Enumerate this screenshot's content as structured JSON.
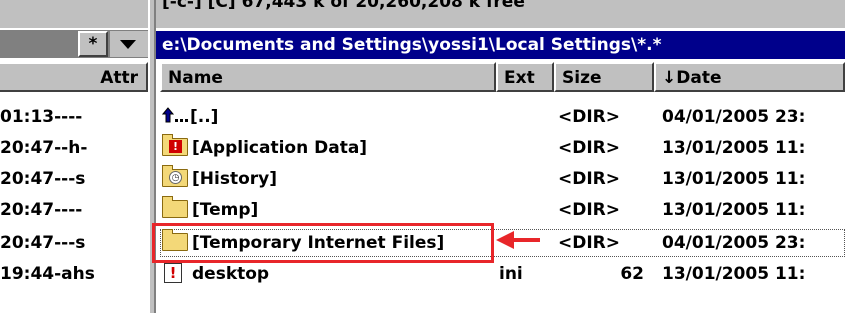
{
  "toolbar_top": {
    "text": "[-c-] [C] 67,443 k of 20,260,208 k free"
  },
  "left_pane": {
    "filter_label": "*",
    "attr_header": "Attr",
    "rows": [
      {
        "attr": "01:13----"
      },
      {
        "attr": "20:47--h-"
      },
      {
        "attr": "20:47---s"
      },
      {
        "attr": "20:47----"
      },
      {
        "attr": "20:47---s"
      },
      {
        "attr": "19:44-ahs"
      }
    ]
  },
  "path_bar": {
    "path": "e:\\Documents and Settings\\yossi1\\Local Settings\\*.*"
  },
  "columns": {
    "name": "Name",
    "ext": "Ext",
    "size": "Size",
    "date": "↓Date"
  },
  "files": [
    {
      "icon": "up-arrow-icon",
      "name": "[..]",
      "ext": "",
      "size": "<DIR>",
      "date": "04/01/2005 23:"
    },
    {
      "icon": "folder-warning-icon",
      "name": "[Application Data]",
      "ext": "",
      "size": "<DIR>",
      "date": "13/01/2005 11:"
    },
    {
      "icon": "folder-history-icon",
      "name": "[History]",
      "ext": "",
      "size": "<DIR>",
      "date": "13/01/2005 11:"
    },
    {
      "icon": "folder-icon",
      "name": "[Temp]",
      "ext": "",
      "size": "<DIR>",
      "date": "13/01/2005 11:"
    },
    {
      "icon": "folder-icon",
      "name": "[Temporary Internet Files]",
      "ext": "",
      "size": "<DIR>",
      "date": "04/01/2005 23:"
    },
    {
      "icon": "file-warning-icon",
      "name": "desktop",
      "ext": "ini",
      "size": "62",
      "date": "13/01/2005 11:"
    }
  ],
  "annotation": {
    "color": "#e8262a"
  },
  "colors": {
    "path_bar_bg": "#00008b",
    "panel_gray": "#c0c0c0"
  }
}
